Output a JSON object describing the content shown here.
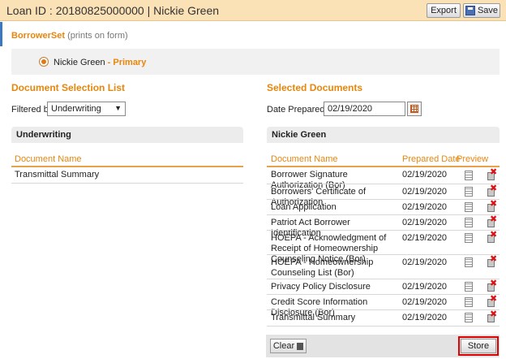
{
  "header": {
    "title": "Loan ID : 20180825000000 | Nickie Green",
    "export_label": "Export",
    "save_label": "Save"
  },
  "borrower_set": {
    "title": "BorrowerSet",
    "note": "(prints on form)",
    "borrower_name": "Nickie Green",
    "borrower_separator": " - ",
    "borrower_role": "Primary"
  },
  "document_selection": {
    "title": "Document Selection List",
    "filter_label": "Filtered by",
    "filter_value": "Underwriting",
    "panel_title": "Underwriting",
    "column_header": "Document Name",
    "documents": [
      "Transmittal Summary"
    ]
  },
  "selected_documents": {
    "title": "Selected Documents",
    "date_label": "Date Prepared",
    "date_value": "02/19/2020",
    "panel_title": "Nickie Green",
    "columns": {
      "name": "Document Name",
      "date": "Prepared Date",
      "preview": "Preview"
    },
    "rows": [
      {
        "name": "Borrower Signature Authorization (Bor)",
        "date": "02/19/2020"
      },
      {
        "name": "Borrowers' Certificate of Authorization",
        "date": "02/19/2020"
      },
      {
        "name": "Loan Application",
        "date": "02/19/2020"
      },
      {
        "name": "Patriot Act Borrower Identification",
        "date": "02/19/2020"
      },
      {
        "name": "HOEPA - Acknowledgment of Receipt of Homeownership Counseling Notice (Bor)",
        "date": "02/19/2020"
      },
      {
        "name": "HOEPA - Homeownership Counseling List (Bor)",
        "date": "02/19/2020"
      },
      {
        "name": "Privacy Policy Disclosure",
        "date": "02/19/2020"
      },
      {
        "name": "Credit Score Information Disclosure (Bor)",
        "date": "02/19/2020"
      },
      {
        "name": "Transmittal Summary",
        "date": "02/19/2020"
      }
    ]
  },
  "footer": {
    "clear_label": "Clear",
    "store_label": "Store"
  },
  "colors": {
    "accent": "#e8860c",
    "header_bg": "#fbe1b6",
    "highlight": "#dd0000"
  }
}
